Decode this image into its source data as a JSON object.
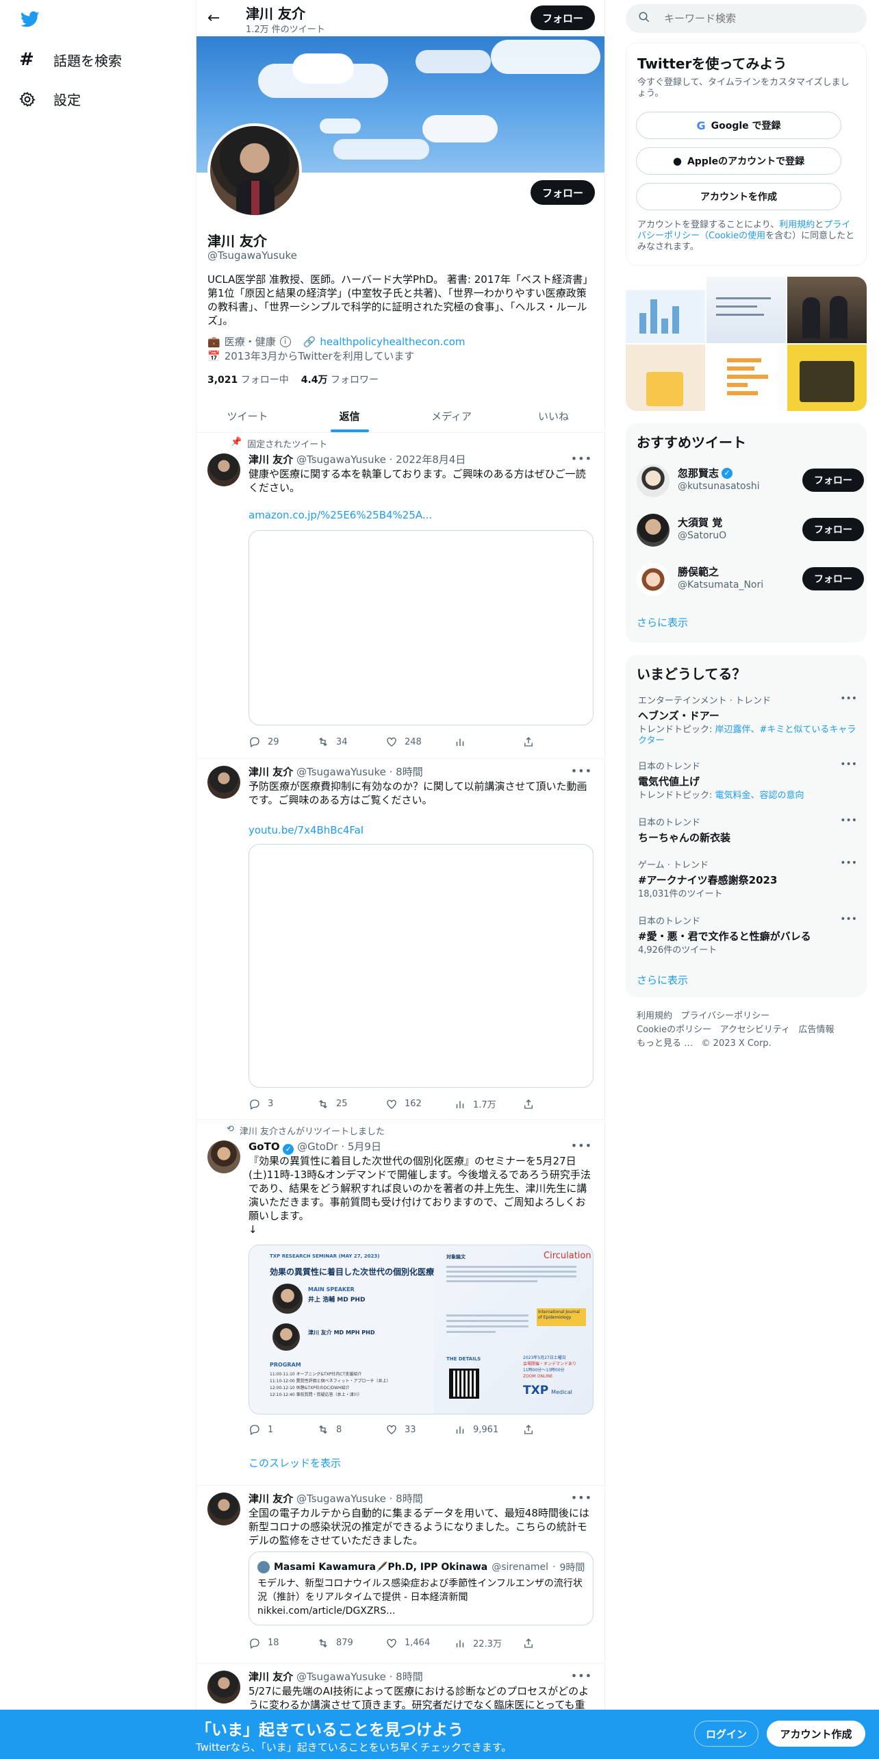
{
  "nav": {
    "explore": "話題を検索",
    "settings": "設定"
  },
  "header": {
    "name": "津川 友介",
    "tweet_count": "1.2万 件のツイート",
    "follow": "フォロー"
  },
  "profile": {
    "name": "津川 友介",
    "handle": "@TsugawaYusuke",
    "follow": "フォロー",
    "bio": "UCLA医学部 准教授、医師。ハーバード大学PhD。 著書: 2017年「ベスト経済書」第1位「原因と結果の経済学」(中室牧子氏と共著)、「世界一わかりやすい医療政策の教科書」、「世界一シンプルで科学的に証明された究極の食事」、「ヘルス・ルールズ」。",
    "category": "医療・健康",
    "website": "healthpolicyhealthecon.com",
    "joined": "2013年3月からTwitterを利用しています",
    "following_count": "3,021",
    "following_label": "フォロー中",
    "followers_count": "4.4万",
    "followers_label": "フォロワー"
  },
  "tabs": [
    "ツイート",
    "返信",
    "メディア",
    "いいね"
  ],
  "tweets": [
    {
      "pinned_label": "固定されたツイート",
      "name": "津川 友介",
      "handle": "@TsugawaYusuke",
      "time": "2022年8月4日",
      "text": "健康や医療に関する本を執筆しております。ご興味のある方はぜひご一読ください。",
      "link": "amazon.co.jp/%25E6%25B4%25A...",
      "replies": "29",
      "retweets": "34",
      "likes": "248",
      "views": ""
    },
    {
      "name": "津川 友介",
      "handle": "@TsugawaYusuke",
      "time": "8時間",
      "text": "予防医療が医療費抑制に有効なのか？に関して以前講演させて頂いた動画です。ご興味のある方はご覧ください。",
      "link": "youtu.be/7x4BhBc4FaI",
      "replies": "3",
      "retweets": "25",
      "likes": "162",
      "views": "1.7万"
    },
    {
      "retweet_label": "津川 友介さんがリツイートしました",
      "name": "GoTO",
      "handle": "@GtoDr",
      "time": "5月9日",
      "text": "『効果の異質性に着目した次世代の個別化医療』のセミナーを5月27日(土)11時-13時&オンデマンドで開催します。今後増えるであろう研究手法であり、結果をどう解釈すれば良いのかを著者の井上先生、津川先生に講演いただきます。事前質問も受け付けておりますので、ご周知よろしくお願いします。\n↓",
      "replies": "1",
      "retweets": "8",
      "likes": "33",
      "views": "9,961",
      "show_thread": "このスレッドを表示",
      "poster": {
        "series": "TXP RESEARCH SEMINAR (MAY 27, 2023)",
        "title": "効果の異質性に着目した次世代の個別化医療",
        "speaker_label": "MAIN SPEAKER",
        "speaker_name": "井上 浩輔 MD PHD",
        "speaker2_name": "津川 友介 MD MPH PHD",
        "program_label": "PROGRAM",
        "program": [
          "11:00-11:10 オープニング&TXP社内CT支援紹介",
          "11:10-12:00 異質性評価と個ベネフィット・アプローチ（井上）",
          "12:00-12:10 休憩&TXP社のDC/DWH紹介",
          "12:10-12:40 事前質問・質疑応答（井上・津川）"
        ],
        "refs_label": "対象論文",
        "journal1": "Circulation",
        "journal2": "International Journal of Epidemiology",
        "details_label": "THE DETAILS",
        "date": "2023年5月27日土曜日",
        "mode": "会場開催・オンデマンドあり",
        "time": "11時00分〜13時00分",
        "zoom": "ZOOM ONLINE",
        "brand": "TXP",
        "brand_sub": "Medical"
      }
    },
    {
      "name": "津川 友介",
      "handle": "@TsugawaYusuke",
      "time": "8時間",
      "text": "全国の電子カルテから自動的に集まるデータを用いて、最短48時間後には新型コロナの感染状況の推定ができるようになりました。こちらの統計モデルの監修をさせていただきました。",
      "quote_name": "Masami Kawamura🖋️Ph.D, IPP Okinawa",
      "quote_handle": "@sirenamel",
      "quote_time": "9時間",
      "quote_text": "モデルナ、新型コロナウイルス感染症および季節性インフルエンザの流行状況（推計）をリアルタイムで提供 - 日本経済新聞",
      "quote_link": "nikkei.com/article/DGXZRS...",
      "replies": "18",
      "retweets": "879",
      "likes": "1,464",
      "views": "22.3万"
    },
    {
      "name": "津川 友介",
      "handle": "@TsugawaYusuke",
      "time": "8時間",
      "text": "5/27に最先端のAI技術によって医療における診断などのプロセスがどのように変わるか講演させて頂きます。研究者だけでなく臨床医にとっても重"
    }
  ],
  "search": {
    "placeholder": "キーワード検索"
  },
  "signup": {
    "title": "Twitterを使ってみよう",
    "subtitle": "今すぐ登録して、タイムラインをカスタマイズしましょう。",
    "google": "Google で登録",
    "apple": "Appleのアカウントで登録",
    "create": "アカウントを作成",
    "legal_pre": "アカウントを登録することにより、",
    "legal_terms": "利用規約",
    "legal_and": "と",
    "legal_privacy": "プライバシーポリシー（Cookieの使用",
    "legal_post": "を含む）に同意したとみなされます。"
  },
  "recommended": {
    "title": "おすすめツイート",
    "users": [
      {
        "name": "忽那賢志",
        "handle": "@kutsunasatoshi",
        "verified": true,
        "follow": "フォロー"
      },
      {
        "name": "大須賀 覚",
        "handle": "@SatoruO",
        "verified": false,
        "follow": "フォロー"
      },
      {
        "name": "勝俣範之",
        "handle": "@Katsumata_Nori",
        "verified": false,
        "follow": "フォロー"
      }
    ],
    "more": "さらに表示"
  },
  "trends": {
    "title": "いまどうしてる？",
    "items": [
      {
        "category": "エンターテインメント · トレンド",
        "name": "ヘブンズ・ドアー",
        "sub_pre": "トレンドトピック: ",
        "sub_links": "岸辺露伴、#キミと似ているキャラクター"
      },
      {
        "category": "日本のトレンド",
        "name": "電気代値上げ",
        "sub_pre": "トレンドトピック: ",
        "sub_links": "電気料金、容認の意向"
      },
      {
        "category": "日本のトレンド",
        "name": "ちーちゃんの新衣装",
        "sub_pre": "",
        "sub_links": ""
      },
      {
        "category": "ゲーム · トレンド",
        "name": "#アークナイツ春感謝祭2023",
        "sub_pre": "18,031件のツイート",
        "sub_links": ""
      },
      {
        "category": "日本のトレンド",
        "name": "#愛・悪・君で文作ると性癖がバレる",
        "sub_pre": "4,926件のツイート",
        "sub_links": ""
      }
    ],
    "more": "さらに表示"
  },
  "footer": {
    "links": [
      "利用規約",
      "プライバシーポリシー",
      "Cookieのポリシー",
      "アクセシビリティ",
      "広告情報",
      "もっと見る …"
    ],
    "copyright": "© 2023 X Corp."
  },
  "bottom_bar": {
    "title": "「いま」起きていることを見つけよう",
    "subtitle": "Twitterなら、「いま」起きていることをいち早くチェックできます。",
    "login": "ログイン",
    "signup": "アカウント作成"
  },
  "colors": {
    "accent": "#1d9bf0",
    "text": "#0f1419",
    "muted": "#536471",
    "border": "#eff3f4"
  }
}
